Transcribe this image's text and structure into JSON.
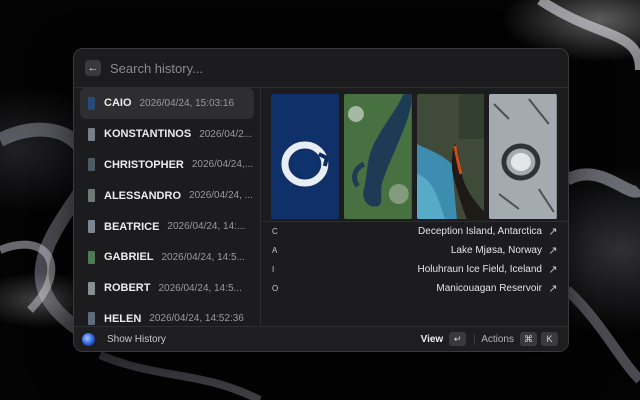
{
  "search": {
    "placeholder": "Search history..."
  },
  "history": [
    {
      "name": "CAIO",
      "date": "2026/04/24, 15:03:16",
      "selected": true,
      "thumb_color": "#274a7a"
    },
    {
      "name": "KONSTANTINOS",
      "date": "2026/04/2...",
      "selected": false,
      "thumb_color": "#7a7f86"
    },
    {
      "name": "CHRISTOPHER",
      "date": "2026/04/24,...",
      "selected": false,
      "thumb_color": "#4f5a62"
    },
    {
      "name": "ALESSANDRO",
      "date": "2026/04/24, ...",
      "selected": false,
      "thumb_color": "#6f7a74"
    },
    {
      "name": "BEATRICE",
      "date": "2026/04/24, 14:...",
      "selected": false,
      "thumb_color": "#7b8690"
    },
    {
      "name": "GABRIEL",
      "date": "2026/04/24, 14:5...",
      "selected": false,
      "thumb_color": "#4e7a55"
    },
    {
      "name": "ROBERT",
      "date": "2026/04/24, 14:5...",
      "selected": false,
      "thumb_color": "#8a8f93"
    },
    {
      "name": "HELEN",
      "date": "2026/04/24, 14:52:36",
      "selected": false,
      "thumb_color": "#5d6c78"
    }
  ],
  "detail": {
    "images": [
      {
        "label": "Deception Island satellite image"
      },
      {
        "label": "Lake Mjøsa satellite image"
      },
      {
        "label": "Holuhraun Ice Field satellite image"
      },
      {
        "label": "Manicouagan Reservoir satellite image"
      }
    ],
    "rows": [
      {
        "letter": "C",
        "place": "Deception Island, Antarctica"
      },
      {
        "letter": "A",
        "place": "Lake Mjøsa, Norway"
      },
      {
        "letter": "I",
        "place": "Holuhraun Ice Field, Iceland"
      },
      {
        "letter": "O",
        "place": "Manicouagan Reservoir"
      }
    ]
  },
  "footer": {
    "title": "Show History",
    "view_label": "View",
    "view_key": "↵",
    "actions_label": "Actions",
    "actions_key_cmd": "⌘",
    "actions_key_k": "K"
  },
  "icons": {
    "back": "arrow-left-icon",
    "open": "arrow-up-right-icon",
    "app": "globe-icon"
  },
  "colors": {
    "window_bg": "#1c1c1e",
    "selected_bg": "#2e2e30",
    "text_primary": "#ececec",
    "text_secondary": "#9a9a9e"
  }
}
